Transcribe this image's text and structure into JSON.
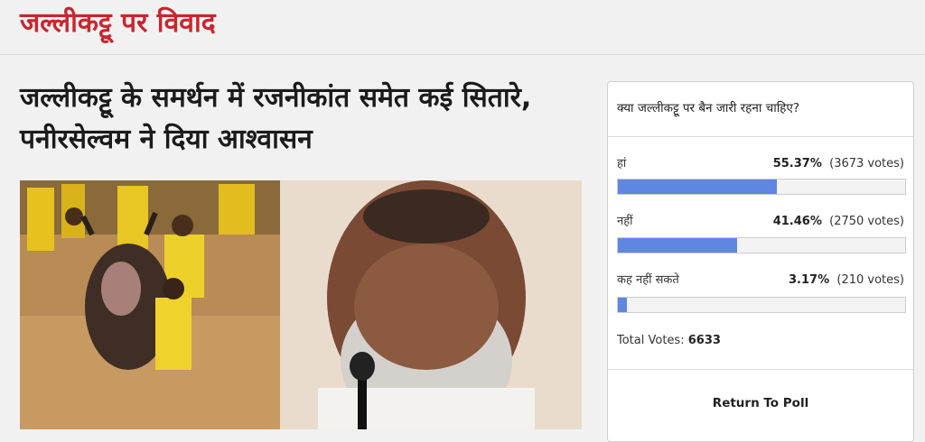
{
  "section": {
    "title": "जल्लीकट्टू पर विवाद"
  },
  "article": {
    "headline": "जल्लीकट्टू के समर्थन में रजनीकांत समेत कई सितारे, पनीरसेल्वम ने दिया आश्वासन"
  },
  "poll": {
    "question": "क्या जल्लीकट्टू पर बैन जारी रहना चाहिए?",
    "options": [
      {
        "label": "हां",
        "percent": "55.37%",
        "votes": "(3673 votes)",
        "fraction": 0.5537
      },
      {
        "label": "नहीं",
        "percent": "41.46%",
        "votes": "(2750 votes)",
        "fraction": 0.4146
      },
      {
        "label": "कह नहीं सकते",
        "percent": "3.17%",
        "votes": "(210 votes)",
        "fraction": 0.0317
      }
    ],
    "total_label": "Total Votes:",
    "total_value": "6633",
    "return_label": "Return To Poll"
  },
  "colors": {
    "brand_red": "#c8262f",
    "bar_blue": "#5f86e0"
  }
}
